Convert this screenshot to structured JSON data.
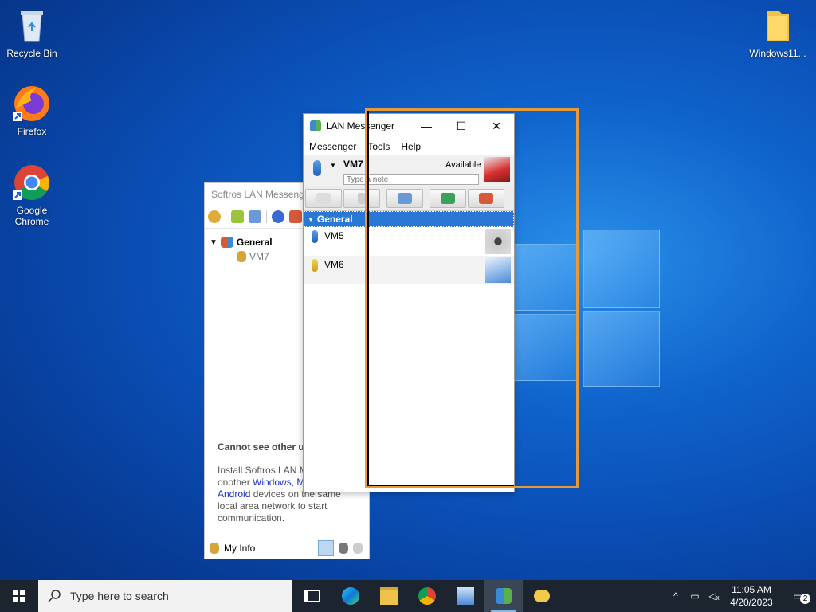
{
  "desktop": {
    "icons": [
      {
        "label": "Recycle Bin"
      },
      {
        "label": "Firefox"
      },
      {
        "label": "Google Chrome"
      },
      {
        "label": "Windows11..."
      }
    ]
  },
  "softros": {
    "title": "Softros LAN Messenger",
    "tree": {
      "group": "General",
      "member": "VM7"
    },
    "info_heading": "Cannot see other us",
    "info_line1": "Install Softros LAN M",
    "info_line2_pre": "onother ",
    "info_link1": "Windows, M",
    "info_link2": "Android",
    "info_line3_post": " devices on the same",
    "info_line4": "local area network to start",
    "info_line5": "communication.",
    "my_info_label": "My Info"
  },
  "lan": {
    "title": "LAN Messenger",
    "menu": [
      "Messenger",
      "Tools",
      "Help"
    ],
    "user": {
      "name": "VM7",
      "status": "Available",
      "note_placeholder": "Type a note"
    },
    "group": "General",
    "contacts": [
      {
        "name": "VM5"
      },
      {
        "name": "VM6"
      }
    ]
  },
  "taskbar": {
    "search_placeholder": "Type here to search",
    "time": "11:05 AM",
    "date": "4/20/2023",
    "notification_count": "2"
  },
  "colors": {
    "accent": "#2a78d6",
    "overlay_frame": "#e69a3a"
  }
}
